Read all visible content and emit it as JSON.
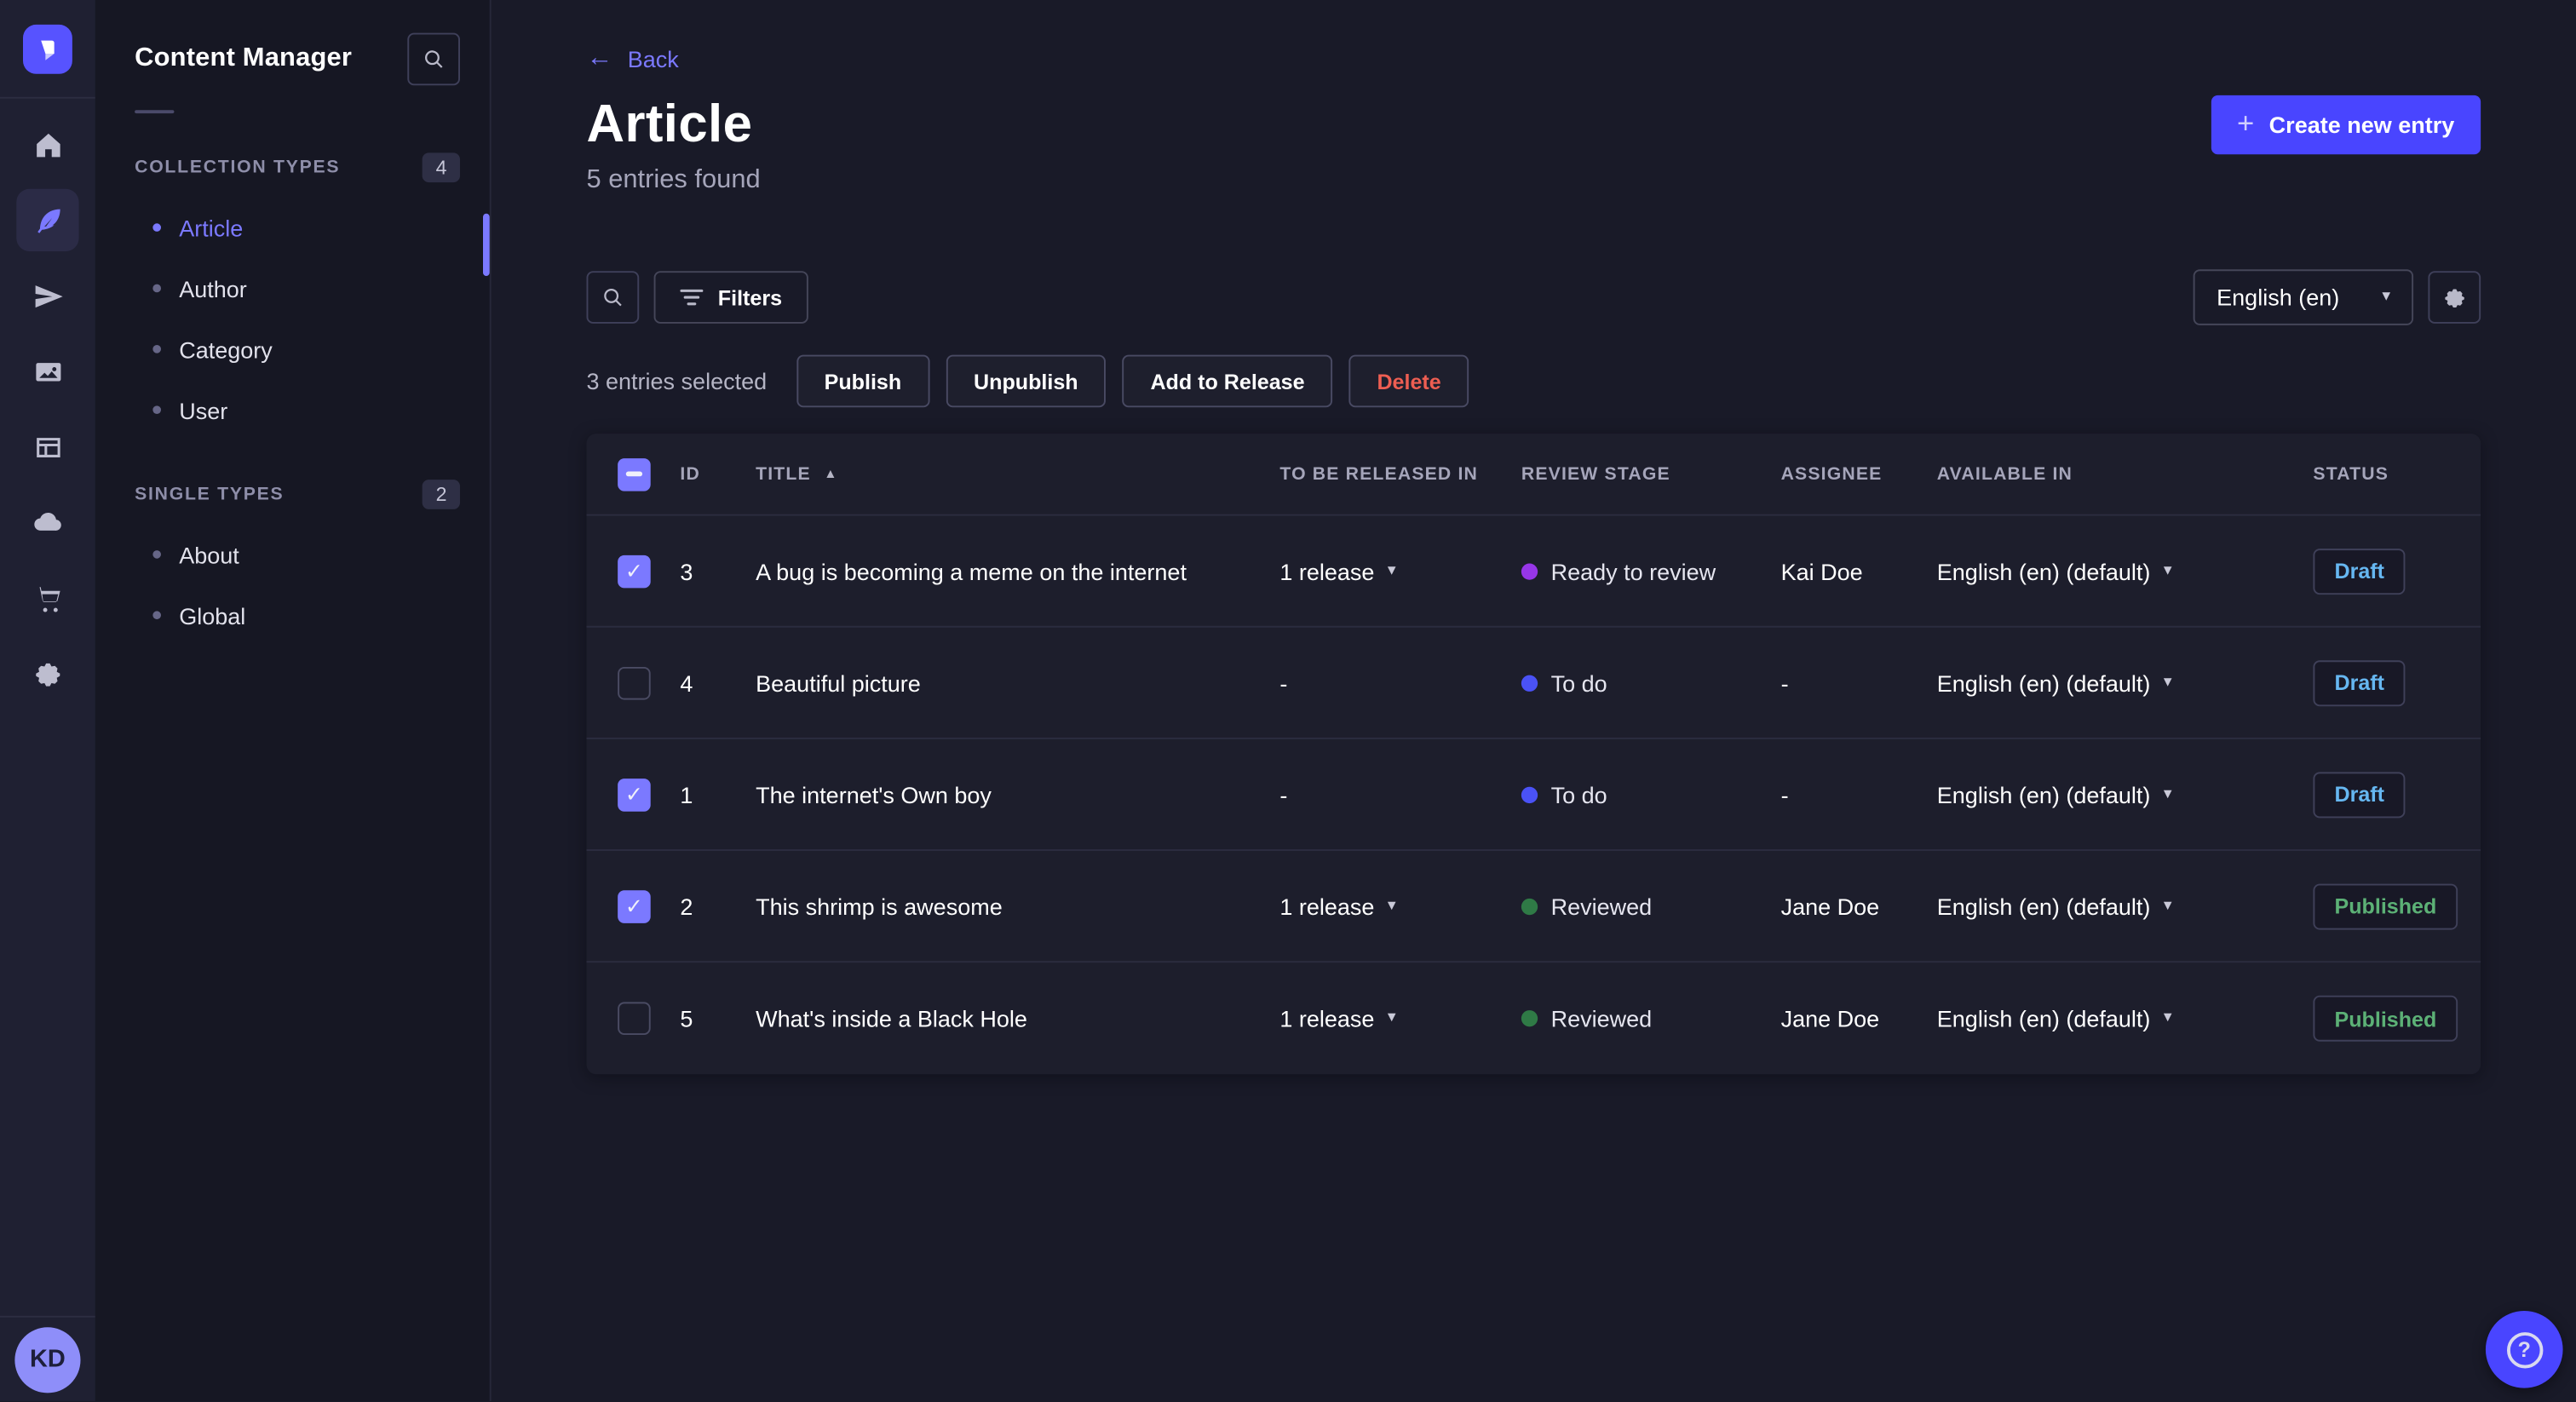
{
  "nav_rail": {
    "items": [
      {
        "icon": "home-icon",
        "active": false
      },
      {
        "icon": "content-manager-icon",
        "active": true
      },
      {
        "icon": "releases-icon",
        "active": false
      },
      {
        "icon": "media-library-icon",
        "active": false
      },
      {
        "icon": "content-type-builder-icon",
        "active": false
      },
      {
        "icon": "deploy-icon",
        "active": false
      },
      {
        "icon": "marketplace-icon",
        "active": false
      },
      {
        "icon": "settings-icon",
        "active": false
      }
    ]
  },
  "user": {
    "initials": "KD"
  },
  "sidebar": {
    "title": "Content Manager",
    "collection_types": {
      "label": "COLLECTION TYPES",
      "count": "4",
      "items": [
        {
          "label": "Article",
          "active": true
        },
        {
          "label": "Author",
          "active": false
        },
        {
          "label": "Category",
          "active": false
        },
        {
          "label": "User",
          "active": false
        }
      ]
    },
    "single_types": {
      "label": "SINGLE TYPES",
      "count": "2",
      "items": [
        {
          "label": "About",
          "active": false
        },
        {
          "label": "Global",
          "active": false
        }
      ]
    }
  },
  "header": {
    "back": "Back",
    "title": "Article",
    "subtitle": "5 entries found",
    "create_button": "Create new entry"
  },
  "toolbar": {
    "filters_label": "Filters",
    "locale": "English (en)"
  },
  "selection": {
    "text": "3 entries selected",
    "publish": "Publish",
    "unpublish": "Unpublish",
    "add_to_release": "Add to Release",
    "delete": "Delete"
  },
  "table": {
    "select_all_state": "indeterminate",
    "columns": [
      "ID",
      "TITLE",
      "TO BE RELEASED IN",
      "REVIEW STAGE",
      "ASSIGNEE",
      "AVAILABLE IN",
      "STATUS"
    ],
    "sorted_column": "TITLE",
    "sort_direction": "asc",
    "status_colors": {
      "Draft": "#66b7f1",
      "Published": "#5cb176"
    },
    "rows": [
      {
        "checked": true,
        "id": "3",
        "title": "A bug is becoming a meme on the internet",
        "release": "1 release",
        "stage": "Ready to review",
        "stage_color": "#9736e8",
        "assignee": "Kai Doe",
        "locale": "English (en) (default)",
        "status": "Draft"
      },
      {
        "checked": false,
        "id": "4",
        "title": "Beautiful picture",
        "release": "-",
        "stage": "To do",
        "stage_color": "#4a52f6",
        "assignee": "-",
        "locale": "English (en) (default)",
        "status": "Draft"
      },
      {
        "checked": true,
        "id": "1",
        "title": "The internet's Own boy",
        "release": "-",
        "stage": "To do",
        "stage_color": "#4a52f6",
        "assignee": "-",
        "locale": "English (en) (default)",
        "status": "Draft"
      },
      {
        "checked": true,
        "id": "2",
        "title": "This shrimp is awesome",
        "release": "1 release",
        "stage": "Reviewed",
        "stage_color": "#2f7a46",
        "assignee": "Jane Doe",
        "locale": "English (en) (default)",
        "status": "Published"
      },
      {
        "checked": false,
        "id": "5",
        "title": "What's inside a Black Hole",
        "release": "1 release",
        "stage": "Reviewed",
        "stage_color": "#2f7a46",
        "assignee": "Jane Doe",
        "locale": "English (en) (default)",
        "status": "Published"
      }
    ]
  },
  "colors": {
    "brand": "#4945ff",
    "accent": "#7b79ff",
    "danger": "#ee5e52",
    "draft": "#66b7f1",
    "published": "#5cb176"
  }
}
